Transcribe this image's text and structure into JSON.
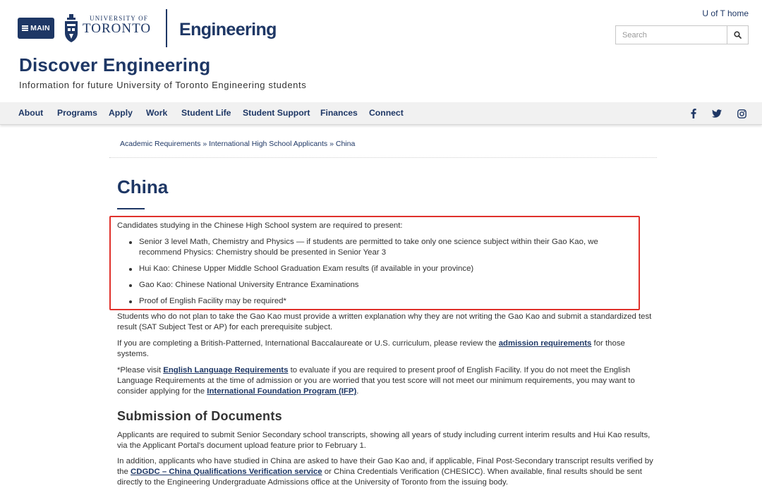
{
  "header": {
    "main_button_label": "MAIN",
    "uoft_small": "UNIVERSITY OF",
    "uoft_big": "TORONTO",
    "faculty": "Engineering",
    "uoft_home": "U of T home",
    "search_placeholder": "Search",
    "brand_color": "#1e3765"
  },
  "site": {
    "title": "Discover Engineering",
    "subtitle": "Information for future University of Toronto Engineering students"
  },
  "nav": {
    "items": [
      "About",
      "Programs",
      "Apply",
      "Work",
      "Student Life",
      "Student Support",
      "Finances",
      "Connect"
    ],
    "social": [
      "facebook-icon",
      "twitter-icon",
      "instagram-icon"
    ]
  },
  "breadcrumb": {
    "c1": "Academic Requirements",
    "sep": "»",
    "c2": "International High School Applicants",
    "c3": "China"
  },
  "page": {
    "title": "China",
    "intro": "Candidates studying in the Chinese High School system are required to present:",
    "bullets": [
      "Senior 3 level Math, Chemistry and Physics — if students are permitted to take only one science subject within their Gao Kao, we recommend Physics: Chemistry should be presented in Senior Year 3",
      "Hui Kao: Chinese Upper Middle School Graduation Exam results (if available in your province)",
      "Gao Kao: Chinese National University Entrance Examinations",
      "Proof of English Facility may be required*"
    ],
    "p_gaokao": "Students who do not plan to take the Gao Kao must provide a written explanation why they are not writing the Gao Kao and submit a standardized test result (SAT Subject Test or AP) for each prerequisite subject.",
    "p_curriculum_a": "If you are completing a British-Patterned, International Baccalaureate or U.S. curriculum, please review the ",
    "p_curriculum_link": "admission requirements",
    "p_curriculum_b": " for those systems.",
    "p_english_a": "*Please visit ",
    "p_english_link1": "English Language Requirements",
    "p_english_b": " to evaluate if you are required to present proof of English Facility. If you do not meet the English Language Requirements at the time of admission or you are worried that you test score will not meet our minimum requirements, you may want to consider applying for the ",
    "p_english_link2": "International Foundation Program (IFP)",
    "p_english_c": ".",
    "h2": "Submission of Documents",
    "p_submit": "Applicants are required to submit Senior Secondary school transcripts, showing all years of study including current interim results and Hui Kao results, via the Applicant Portal's document upload feature prior to February 1.",
    "p_addition_a": "In addition, applicants who have studied in China are asked to have their Gao Kao and, if applicable, Final Post-Secondary transcript results verified by the ",
    "p_addition_link": "CDGDC – China Qualifications Verification service",
    "p_addition_b": " or China Credentials Verification (CHESICC). When available, final results should be sent directly to the Engineering Undergraduate Admissions office at the University of Toronto from the issuing body.",
    "highlight_color": "#e0312b"
  }
}
